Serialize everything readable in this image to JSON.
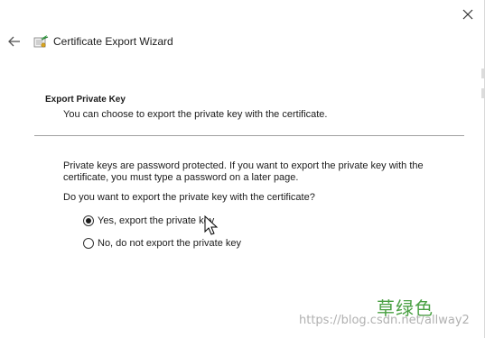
{
  "window": {
    "title": "Certificate Export Wizard",
    "icons": {
      "close": "close-icon",
      "back": "arrow-left-icon",
      "wizard": "certificate-icon"
    }
  },
  "section": {
    "heading": "Export Private Key",
    "subheading": "You can choose to export the private key with the certificate."
  },
  "body": {
    "paragraph1": "Private keys are password protected. If you want to export the private key with the certificate, you must type a password on a later page.",
    "question": "Do you want to export the private key with the certificate?"
  },
  "options": [
    {
      "label": "Yes, export the private key",
      "selected": true
    },
    {
      "label": "No, do not export the private key",
      "selected": false
    }
  ],
  "watermark": {
    "chinese": "草绿色",
    "url": "https://blog.csdn.net/allway2"
  },
  "colors": {
    "accent_green": "#4aa043",
    "divider": "#a0a0a0",
    "text": "#1b1b1b"
  }
}
